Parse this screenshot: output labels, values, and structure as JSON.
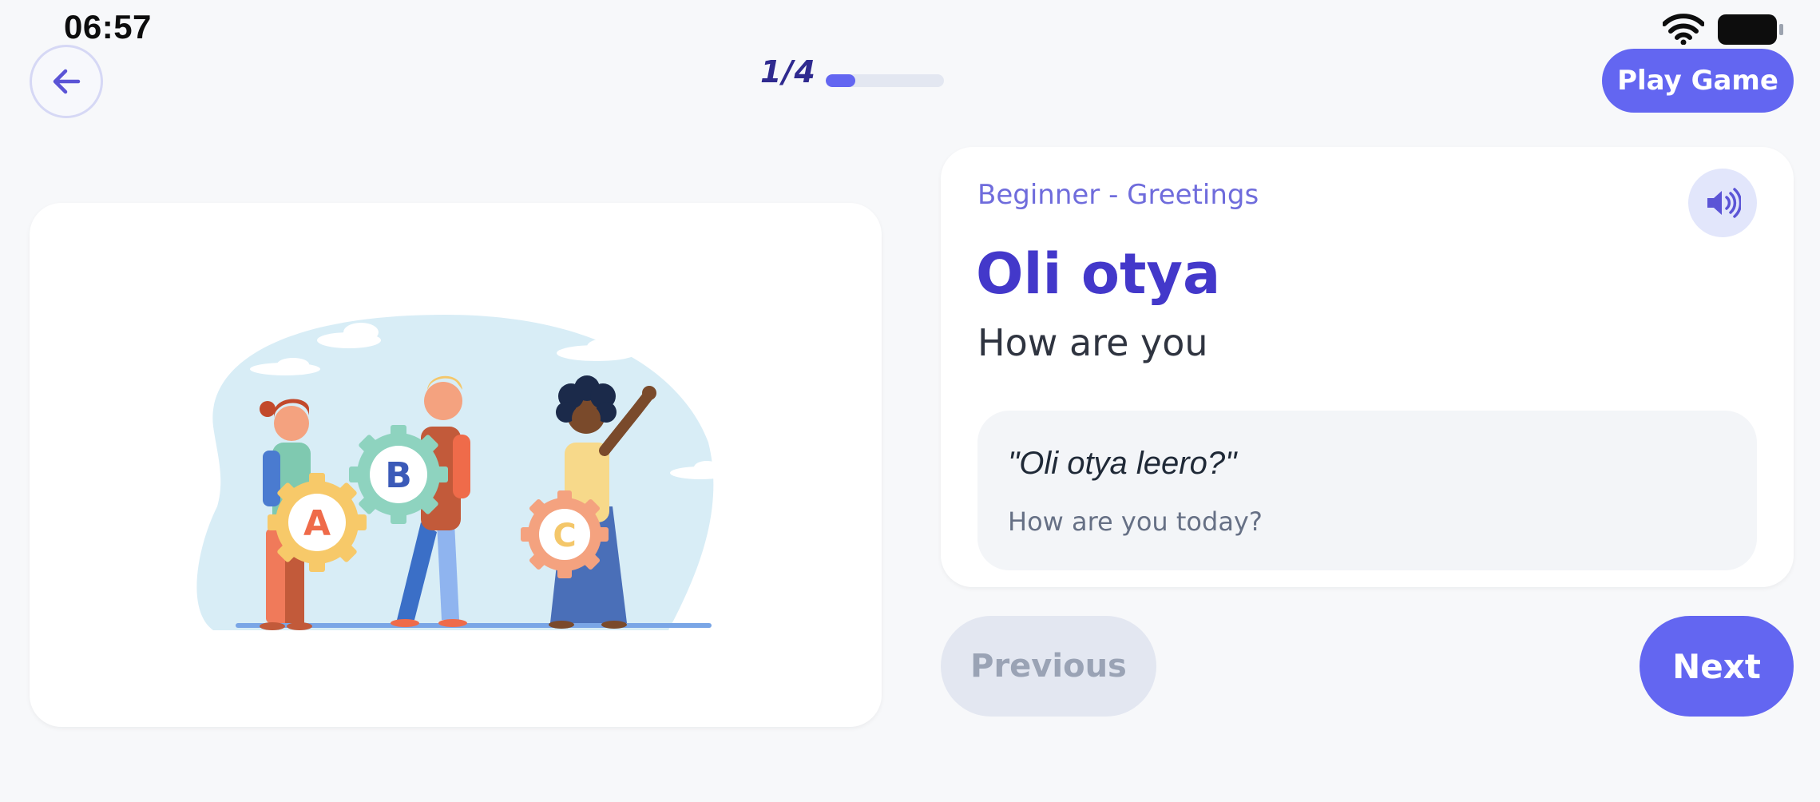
{
  "status_bar": {
    "time": "06:57",
    "wifi_icon": "wifi-icon",
    "battery_icon": "battery-icon"
  },
  "header": {
    "back_icon": "arrow-left-icon",
    "progress_label": "1/4",
    "progress_fraction": 0.25,
    "play_game_label": "Play Game"
  },
  "illustration": {
    "subject": "children-holding-abc-gears",
    "letters": [
      "A",
      "B",
      "C"
    ]
  },
  "phrase_card": {
    "category": "Beginner - Greetings",
    "speaker_icon": "volume-icon",
    "word": "Oli otya",
    "translation": "How are you",
    "example": {
      "sentence": "\"Oli otya leero?\"",
      "translation": "How are you today?"
    }
  },
  "navigation": {
    "previous_label": "Previous",
    "next_label": "Next"
  },
  "colors": {
    "accent": "#6366f1",
    "heading": "#4338ca",
    "background": "#f7f8fa"
  }
}
